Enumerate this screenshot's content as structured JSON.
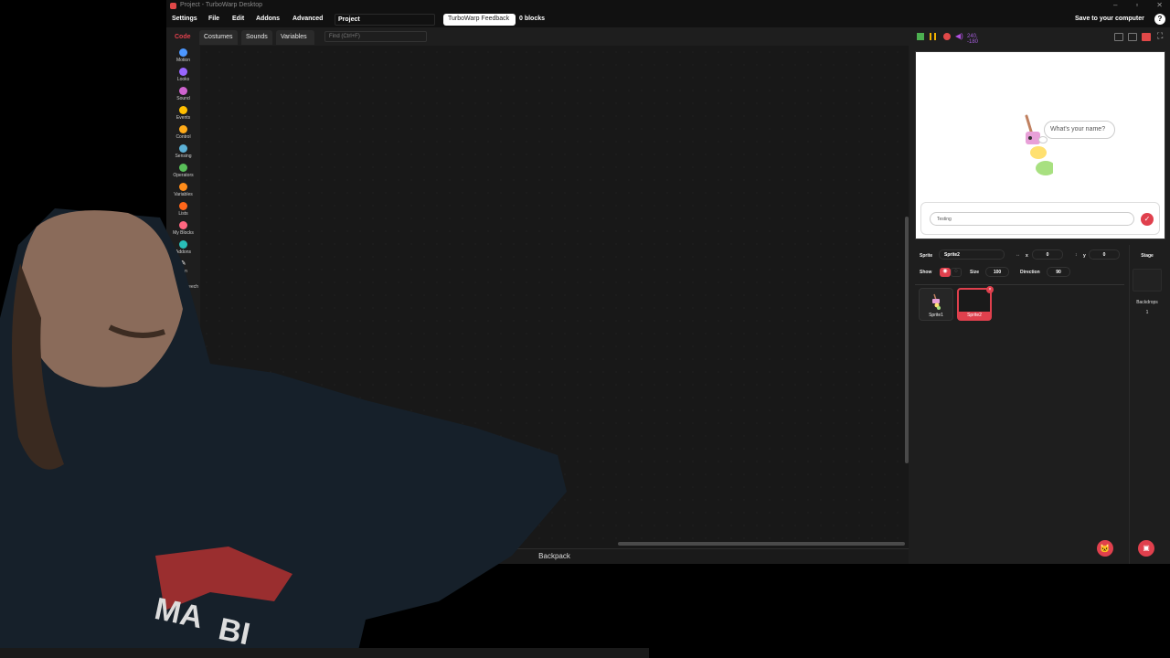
{
  "window": {
    "title": "Project - TurboWarp Desktop"
  },
  "menu": {
    "settings": "Settings",
    "file": "File",
    "edit": "Edit",
    "addons": "Addons",
    "advanced": "Advanced",
    "project_title": "Project",
    "feedback": "TurboWarp Feedback",
    "blocks_count": "0 blocks",
    "save": "Save to your computer",
    "help": "?"
  },
  "tabs": {
    "code": "Code",
    "costumes": "Costumes",
    "sounds": "Sounds",
    "variables": "Variables"
  },
  "search": {
    "placeholder": "Find (Ctrl+F)"
  },
  "categories": [
    {
      "label": "Motion",
      "color": "#4c97ff"
    },
    {
      "label": "Looks",
      "color": "#9966ff"
    },
    {
      "label": "Sound",
      "color": "#cf63cf"
    },
    {
      "label": "Events",
      "color": "#ffbf00"
    },
    {
      "label": "Control",
      "color": "#ffab19"
    },
    {
      "label": "Sensing",
      "color": "#5cb1d6"
    },
    {
      "label": "Operators",
      "color": "#59c059"
    },
    {
      "label": "Variables",
      "color": "#ff8c1a"
    },
    {
      "label": "Lists",
      "color": "#ff661a"
    },
    {
      "label": "My Blocks",
      "color": "#ff6680"
    },
    {
      "label": "Addons",
      "color": "#29beb8"
    },
    {
      "label": "Pen",
      "color": "#0fbd8c"
    },
    {
      "label": "Text to Speech",
      "color": "#0fbd8c"
    }
  ],
  "backpack": {
    "label": "Backpack"
  },
  "stage": {
    "coords": "240, -180",
    "bubble": "What's your name?",
    "answer": "Testing"
  },
  "sprite_info": {
    "sprite_label": "Sprite",
    "sprite_name": "Sprite2",
    "x_label": "x",
    "x_value": "0",
    "y_label": "y",
    "y_value": "0",
    "show_label": "Show",
    "size_label": "Size",
    "size_value": "100",
    "direction_label": "Direction",
    "direction_value": "90"
  },
  "sprites": [
    {
      "name": "Sprite1"
    },
    {
      "name": "Sprite2"
    }
  ],
  "stage_pane": {
    "title": "Stage",
    "backdrops_label": "Backdrops",
    "backdrops_count": "1"
  },
  "colors": {
    "accent": "#e0404d",
    "background": "#1e1e1e"
  }
}
